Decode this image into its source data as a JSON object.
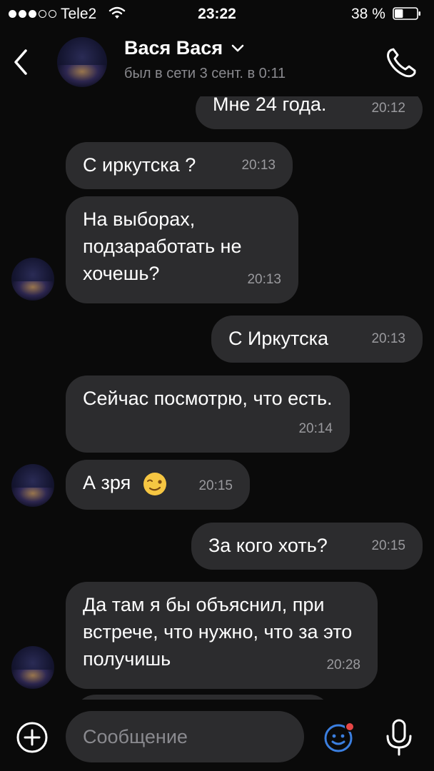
{
  "status_bar": {
    "carrier": "Tele2",
    "time": "23:22",
    "battery_percent": "38 %",
    "battery_level": 0.38
  },
  "header": {
    "name": "Вася Вася",
    "last_seen": "был в сети 3 сент. в 0:11",
    "icons": {
      "back": "chevron-left-icon",
      "dropdown": "chevron-down-icon",
      "call": "phone-icon"
    }
  },
  "messages": [
    {
      "direction": "out",
      "text": "Мне 24 года.",
      "time": "20:12"
    },
    {
      "direction": "in",
      "text": "С иркутска ?",
      "time": "20:13"
    },
    {
      "direction": "in",
      "text": "На выборах, подзаработать не хочешь?",
      "time": "20:13"
    },
    {
      "direction": "out",
      "text": "С Иркутска",
      "time": "20:13"
    },
    {
      "direction": "in",
      "text": "Сейчас посмотрю, что есть.",
      "time": "20:14"
    },
    {
      "direction": "in",
      "text": "А зря",
      "emoji": "winking-face",
      "time": "20:15"
    },
    {
      "direction": "out",
      "text": "За кого хоть?",
      "time": "20:15"
    },
    {
      "direction": "in",
      "text": "Да там я бы объяснил, при встрече, что нужно, что за это получишь",
      "time": "20:28"
    }
  ],
  "composer": {
    "placeholder": "Сообщение",
    "icons": {
      "attach": "plus-circle-icon",
      "sticker": "sticker-icon",
      "voice": "microphone-icon"
    },
    "accent_color": "#3b7fe0",
    "badge_color": "#e64646"
  }
}
